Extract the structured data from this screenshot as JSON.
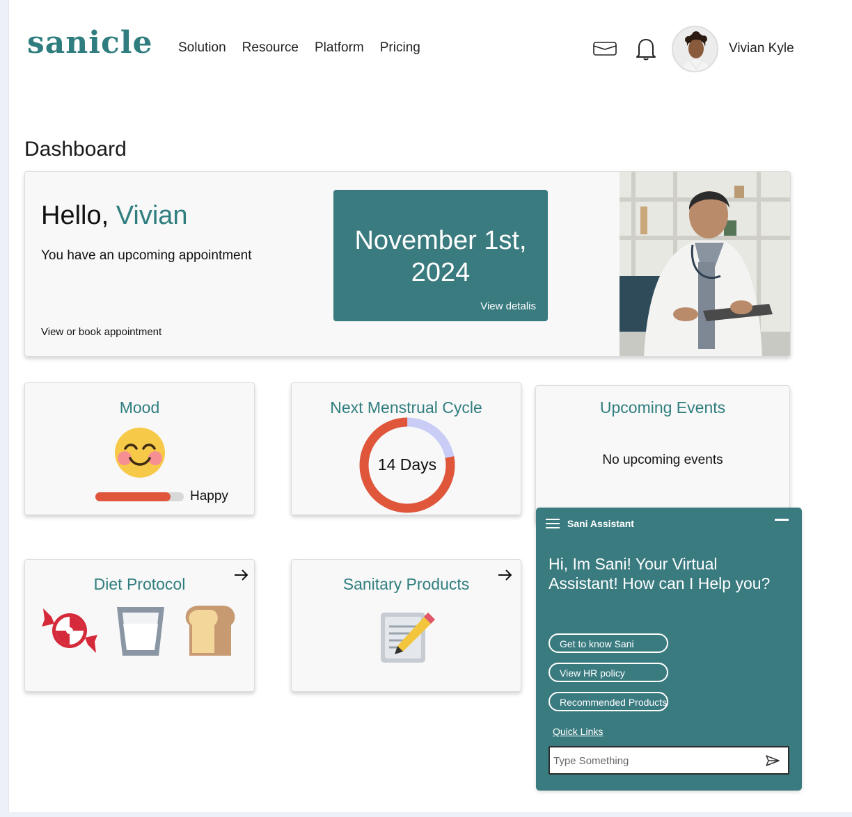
{
  "brand": {
    "logo": "sanicle",
    "accent": "#2f7d7e",
    "panel": "#3a7b80",
    "alert": "#e0563a"
  },
  "nav": {
    "items": [
      "Solution",
      "Resource",
      "Platform",
      "Pricing"
    ]
  },
  "header": {
    "mail_icon": "mail-icon",
    "bell_icon": "bell-icon",
    "user_name": "Vivian Kyle"
  },
  "page": {
    "title": "Dashboard"
  },
  "hero": {
    "greeting": "Hello,",
    "name": "Vivian",
    "subtitle": "You have an upcoming appointment",
    "link": "View or book appointment",
    "appointment": {
      "date": "November 1st, 2024",
      "link": "View detalis"
    }
  },
  "mood": {
    "title": "Mood",
    "icon": "smiling-face-icon",
    "label": "Happy",
    "level": 0.85
  },
  "cycle": {
    "title": "Next Menstrual Cycle",
    "label": "14 Days",
    "progress": 0.78
  },
  "events": {
    "title": "Upcoming Events",
    "empty": "No upcoming events"
  },
  "diet": {
    "title": "Diet Protocol",
    "icons": [
      "candy-icon",
      "milk-glass-icon",
      "bread-icon"
    ]
  },
  "sanitary": {
    "title": "Sanitary Products",
    "icon": "memo-pencil-icon"
  },
  "assistant": {
    "title": "Sani Assistant",
    "greeting": "Hi, Im Sani! Your Virtual Assistant! How can I Help you?",
    "options": [
      "Get to know Sani",
      "View HR policy",
      "Recommended Products"
    ],
    "quick_links": "Quick Links",
    "input_placeholder": "Type Something"
  }
}
